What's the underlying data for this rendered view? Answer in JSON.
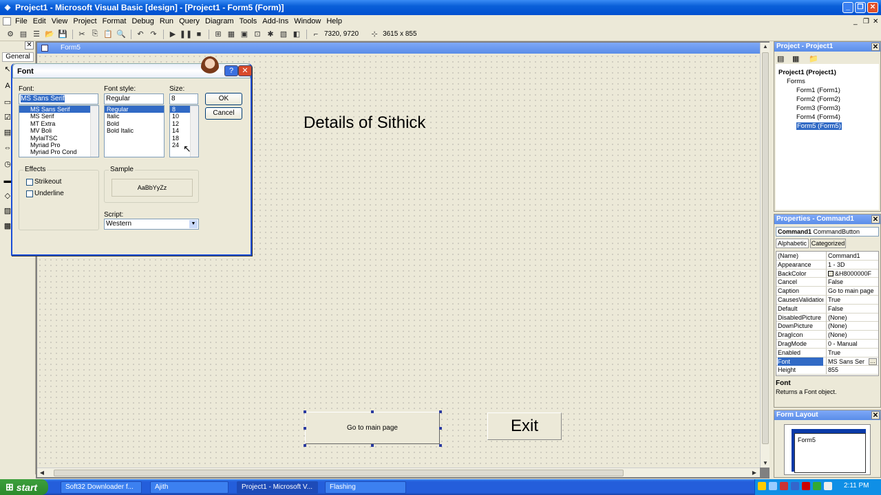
{
  "app": {
    "title": "Project1 - Microsoft Visual Basic [design] - [Project1 - Form5 (Form)]"
  },
  "menu": [
    "File",
    "Edit",
    "View",
    "Project",
    "Format",
    "Debug",
    "Run",
    "Query",
    "Diagram",
    "Tools",
    "Add-Ins",
    "Window",
    "Help"
  ],
  "toolbar": {
    "position": "7320, 9720",
    "size": "3615 x 855"
  },
  "toolbox": {
    "header": "General"
  },
  "form": {
    "window_title": "Form5",
    "label_text": "Details of Sithick",
    "main_button": "Go to main page",
    "exit_button": "Exit"
  },
  "font_dialog": {
    "title": "Font",
    "font_label": "Font:",
    "font_value": "MS Sans Serif",
    "fonts": [
      "MS Sans Serif",
      "MS Serif",
      "MT Extra",
      "MV Boli",
      "MyIaiTSC",
      "Myriad Pro",
      "Myriad Pro Cond"
    ],
    "style_label": "Font style:",
    "style_value": "Regular",
    "styles": [
      "Regular",
      "Italic",
      "Bold",
      "Bold Italic"
    ],
    "size_label": "Size:",
    "size_value": "8",
    "sizes": [
      "8",
      "10",
      "12",
      "14",
      "18",
      "24"
    ],
    "ok": "OK",
    "cancel": "Cancel",
    "effects_label": "Effects",
    "strikeout": "Strikeout",
    "underline": "Underline",
    "sample_label": "Sample",
    "sample_text": "AaBbYyZz",
    "script_label": "Script:",
    "script_value": "Western"
  },
  "project_panel": {
    "title": "Project - Project1",
    "root": "Project1 (Project1)",
    "folder": "Forms",
    "forms": [
      "Form1 (Form1)",
      "Form2 (Form2)",
      "Form3 (Form3)",
      "Form4 (Form4)",
      "Form5 (Form5)"
    ]
  },
  "properties_panel": {
    "title": "Properties - Command1",
    "object_name": "Command1",
    "object_type": "CommandButton",
    "tab_alpha": "Alphabetic",
    "tab_cat": "Categorized",
    "rows": [
      {
        "name": "(Name)",
        "value": "Command1"
      },
      {
        "name": "Appearance",
        "value": "1 - 3D"
      },
      {
        "name": "BackColor",
        "value": "&H8000000F"
      },
      {
        "name": "Cancel",
        "value": "False"
      },
      {
        "name": "Caption",
        "value": "Go to main page"
      },
      {
        "name": "CausesValidation",
        "value": "True"
      },
      {
        "name": "Default",
        "value": "False"
      },
      {
        "name": "DisabledPicture",
        "value": "(None)"
      },
      {
        "name": "DownPicture",
        "value": "(None)"
      },
      {
        "name": "DragIcon",
        "value": "(None)"
      },
      {
        "name": "DragMode",
        "value": "0 - Manual"
      },
      {
        "name": "Enabled",
        "value": "True"
      },
      {
        "name": "Font",
        "value": "MS Sans Ser"
      },
      {
        "name": "Height",
        "value": "855"
      }
    ],
    "desc_title": "Font",
    "desc_text": "Returns a Font object."
  },
  "form_layout": {
    "title": "Form Layout",
    "form_name": "Form5"
  },
  "taskbar": {
    "start": "start",
    "tasks": [
      "Soft32 Downloader f...",
      "Ajith",
      "Project1 - Microsoft V...",
      "Flashing"
    ],
    "clock": "2:11 PM"
  }
}
